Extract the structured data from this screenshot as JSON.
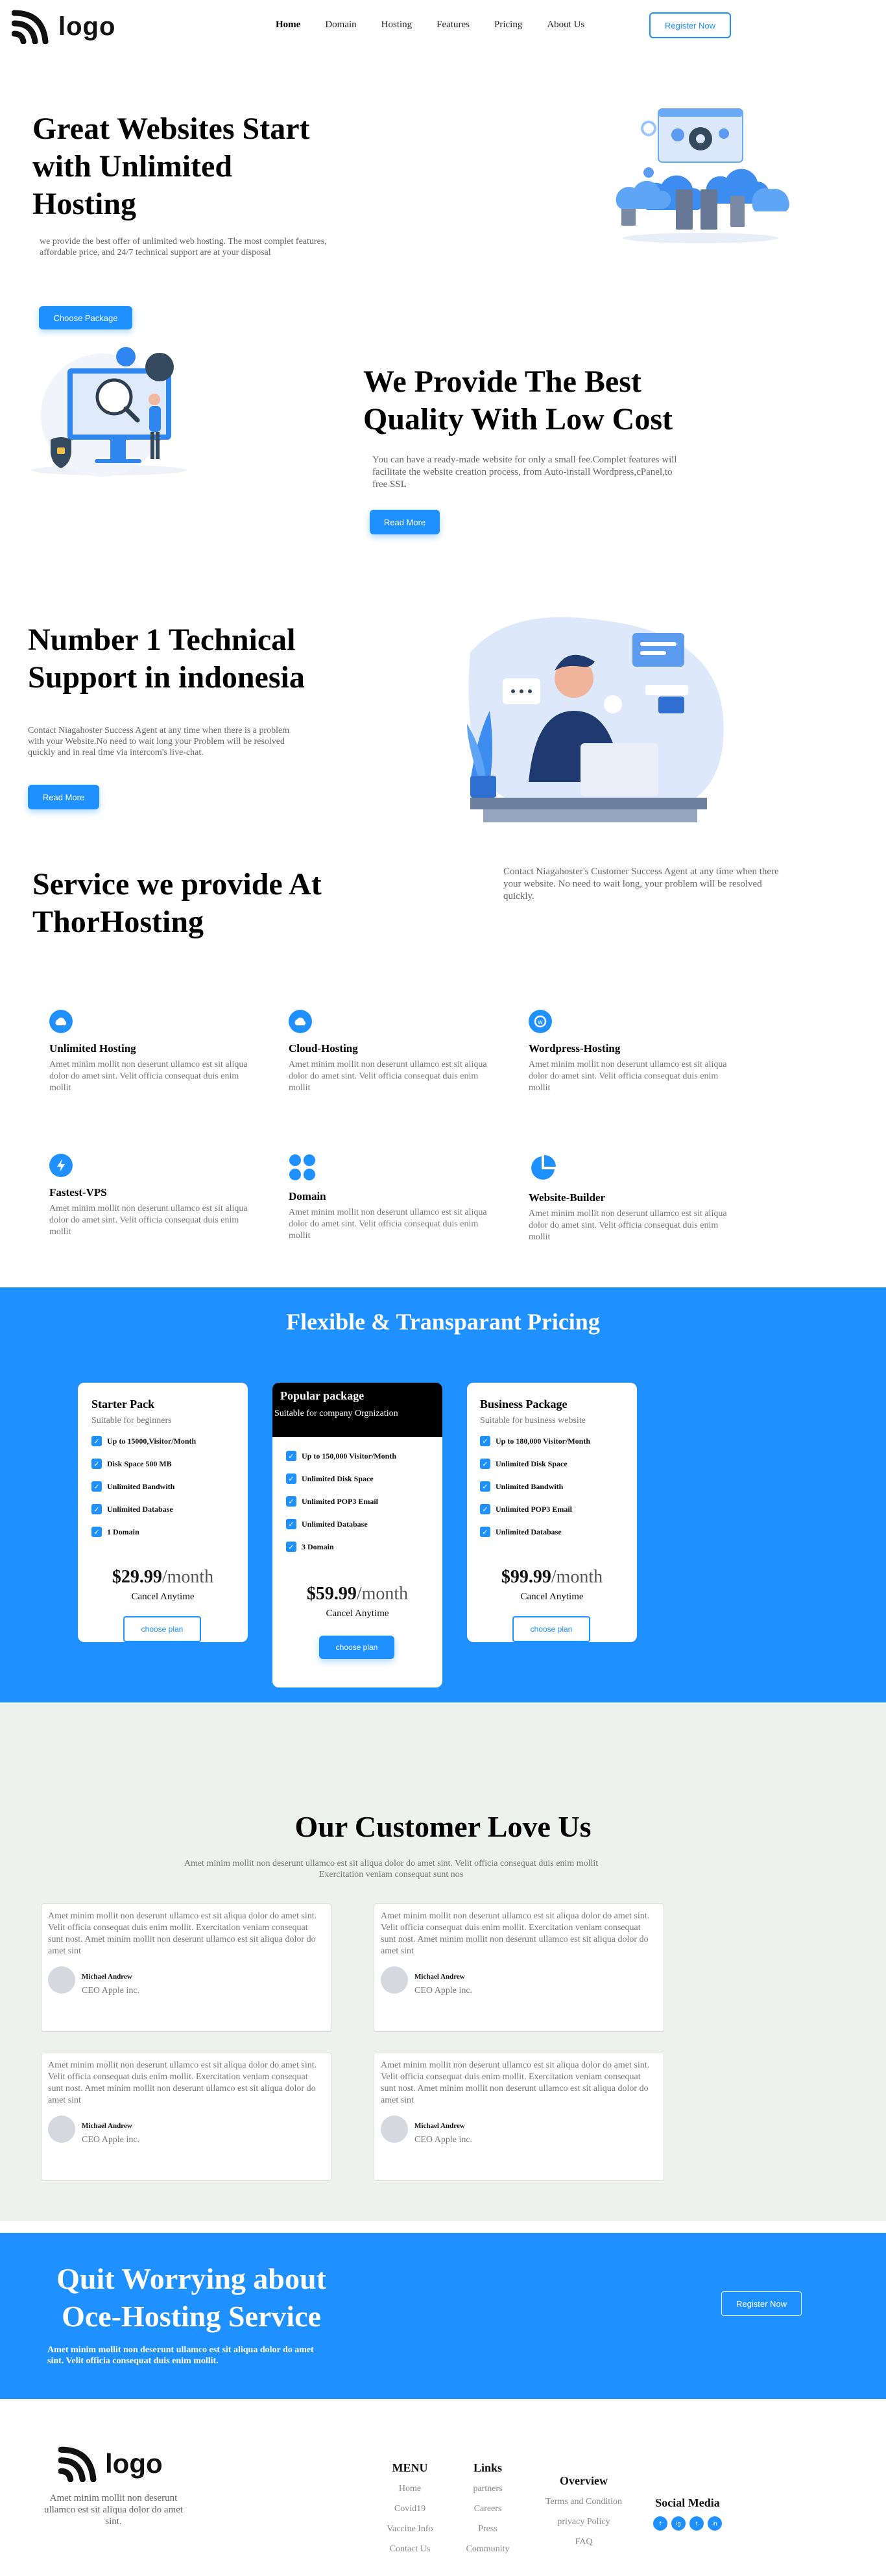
{
  "nav": {
    "logo_text": "logo",
    "links": [
      "Home",
      "Domain",
      "Hosting",
      "Features",
      "Pricing",
      "About Us"
    ],
    "active": "Home",
    "register_label": "Register Now"
  },
  "hero": {
    "title": "Great Websites Start with Unlimited Hosting",
    "description": "we provide the best offer of unlimited web hosting. The most complet features, affordable price, and 24/7 technical support are at your disposal",
    "button_label": "Choose Package"
  },
  "quality": {
    "title": "We Provide The Best Quality With Low Cost",
    "description": "You can have a ready-made website for only a small fee.Complet features will facilitate the website creation process, from Auto-install Wordpress,cPanel,to free SSL",
    "button_label": "Read More"
  },
  "support": {
    "title": "Number 1 Technical Support in indonesia",
    "description": "Contact Niagahoster Success Agent at any time when there is a problem with your Website.No need to wait long your Problem will be resolved quickly and in real time via intercom's live-chat.",
    "button_label": "Read More"
  },
  "services": {
    "title": "Service we provide At ThorHosting",
    "description": "Contact Niagahoster's Customer Success Agent at any time when there your website. No need to wait long, your problem will be resolved quickly.",
    "items": [
      {
        "name": "Unlimited Hosting",
        "icon": "cloud-icon",
        "text": "Amet minim mollit non deserunt ullamco est sit aliqua dolor do amet sint. Velit officia consequat duis enim mollit"
      },
      {
        "name": "Cloud-Hosting",
        "icon": "cloud-icon",
        "text": "Amet minim mollit non deserunt ullamco est sit aliqua dolor do amet sint. Velit officia consequat duis enim mollit"
      },
      {
        "name": "Wordpress-Hosting",
        "icon": "wordpress-icon",
        "text": "Amet minim mollit non deserunt ullamco est sit aliqua dolor do amet sint. Velit officia consequat duis enim mollit"
      },
      {
        "name": "Fastest-VPS",
        "icon": "lightning-icon",
        "text": "Amet minim mollit non deserunt ullamco est sit aliqua dolor do amet sint. Velit officia consequat duis enim mollit"
      },
      {
        "name": "Domain",
        "icon": "grid-dots-icon",
        "text": "Amet minim mollit non deserunt ullamco est sit aliqua dolor do amet sint. Velit officia consequat duis enim mollit"
      },
      {
        "name": "Website-Builder",
        "icon": "pie-chart-icon",
        "text": "Amet minim mollit non deserunt ullamco est sit aliqua dolor do amet sint. Velit officia consequat duis enim mollit"
      }
    ]
  },
  "pricing": {
    "title": "Flexible & Transparant Pricing",
    "plans": [
      {
        "name": "Starter Pack",
        "subtitle": "Suitable for beginners",
        "features": [
          "Up to 15000,Visitor/Month",
          "Disk Space 500 MB",
          "Unlimited Bandwith",
          "Unlimited Database",
          "1 Domain"
        ],
        "price": "$29.99",
        "period": "/month",
        "cancel": "Cancel Anytime",
        "button": "choose plan"
      },
      {
        "name": "Popular package",
        "subtitle": "Suitable for company Orgnization",
        "features": [
          "Up to 150,000 Visitor/Month",
          "Unlimited Disk Space",
          "Unlimited POP3 Email",
          "Unlimited Database",
          "3 Domain"
        ],
        "price": "$59.99",
        "period": "/month",
        "cancel": "Cancel Anytime",
        "button": "choose plan"
      },
      {
        "name": "Business Package",
        "subtitle": "Suitable for business website",
        "features": [
          "Up to 180,000 Visitor/Month",
          "Unlimited Disk Space",
          "Unlimited Bandwith",
          "Unlimited POP3 Email",
          "Unlimited Database"
        ],
        "price": "$99.99",
        "period": "/month",
        "cancel": "Cancel Anytime",
        "button": "choose plan"
      }
    ]
  },
  "testimonials": {
    "title": "Our Customer Love Us",
    "subtitle": "Amet minim mollit non deserunt ullamco est sit aliqua dolor do amet sint. Velit officia consequat duis enim mollit Exercitation veniam consequat sunt nos",
    "items": [
      {
        "text": "Amet minim mollit non deserunt ullamco est sit aliqua dolor do amet sint. Velit officia consequat duis enim mollit. Exercitation veniam consequat sunt nost. Amet minim mollit non deserunt ullamco est sit aliqua dolor do amet sint",
        "name": "Michael Andrew",
        "role": "CEO Apple inc."
      },
      {
        "text": "Amet minim mollit non deserunt ullamco est sit aliqua dolor do amet sint. Velit officia consequat duis enim mollit. Exercitation veniam consequat sunt nost. Amet minim mollit non deserunt ullamco est sit aliqua dolor do amet sint",
        "name": "Michael Andrew",
        "role": "CEO Apple inc."
      },
      {
        "text": "Amet minim mollit non deserunt ullamco est sit aliqua dolor do amet sint. Velit officia consequat duis enim mollit. Exercitation veniam consequat sunt nost. Amet minim mollit non deserunt ullamco est sit aliqua dolor do amet sint",
        "name": "Michael Andrew",
        "role": "CEO Apple inc."
      },
      {
        "text": "Amet minim mollit non deserunt ullamco est sit aliqua dolor do amet sint. Velit officia consequat duis enim mollit. Exercitation veniam consequat sunt nost. Amet minim mollit non deserunt ullamco est sit aliqua dolor do amet sint",
        "name": "Michael Andrew",
        "role": "CEO Apple inc."
      }
    ]
  },
  "cta": {
    "title": "Quit Worrying about Oce-Hosting Service",
    "text": "Amet minim mollit non deserunt ullamco est sit aliqua dolor do amet sint. Velit officia consequat duis enim mollit.",
    "button": "Register Now"
  },
  "footer": {
    "logo_text": "logo",
    "about": "Amet minim mollit non deserunt ullamco est sit aliqua dolor do amet sint.",
    "menu": {
      "title": "MENU",
      "items": [
        "Home",
        "Covid19",
        "Vaccine Info",
        "Contact Us"
      ]
    },
    "links": {
      "title": "Links",
      "items": [
        "partners",
        "Careers",
        "Press",
        "Community"
      ]
    },
    "overview": {
      "title": "Overview",
      "items": [
        "Terms and Condition",
        "privacy Policy",
        "FAQ"
      ]
    },
    "social": {
      "title": "Social Media",
      "items": [
        {
          "icon": "facebook-icon",
          "glyph": "f"
        },
        {
          "icon": "instagram-icon",
          "glyph": "ig"
        },
        {
          "icon": "twitter-icon",
          "glyph": "t"
        },
        {
          "icon": "linkedin-icon",
          "glyph": "in"
        }
      ]
    }
  },
  "colors": {
    "accent": "#1e90ff",
    "testimonial_bg": "#eef2ef",
    "popular_header": "#000000"
  }
}
